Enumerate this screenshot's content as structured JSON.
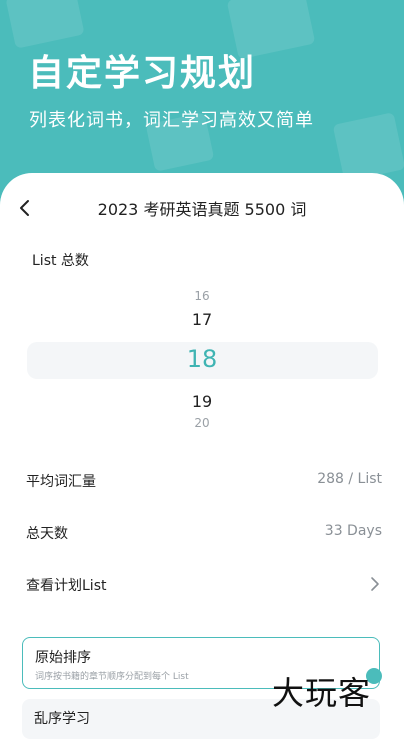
{
  "hero": {
    "title": "自定学习规划",
    "subtitle": "列表化词书，词汇学习高效又简单"
  },
  "header": {
    "title": "2023 考研英语真题 5500 词",
    "back_icon": "chevron-left-icon"
  },
  "list_total": {
    "label": "List 总数",
    "picker": {
      "options": [
        "16",
        "17",
        "18",
        "19",
        "20"
      ],
      "selected": "18"
    }
  },
  "stats": {
    "avg_vocab_label": "平均词汇量",
    "avg_vocab_value": "288 / List",
    "total_days_label": "总天数",
    "total_days_value": "33 Days",
    "view_plan_label": "查看计划List"
  },
  "order_options": {
    "original_title": "原始排序",
    "original_desc": "词序按书籍的章节顺序分配到每个 List",
    "random_title": "乱序学习"
  },
  "watermark": "大玩客",
  "colors": {
    "accent": "#4bbcbb",
    "selected_text": "#3fb4b3",
    "muted": "#8a9096"
  }
}
